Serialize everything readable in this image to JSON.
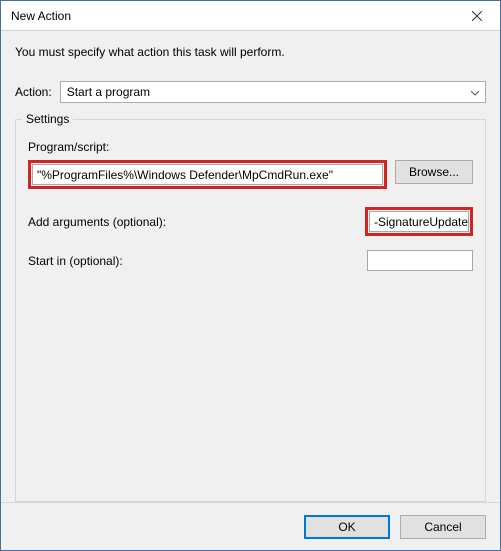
{
  "titlebar": {
    "title": "New Action"
  },
  "instruction": "You must specify what action this task will perform.",
  "action": {
    "label": "Action:",
    "selected": "Start a program"
  },
  "settings": {
    "legend": "Settings",
    "program_label": "Program/script:",
    "program_value": "\"%ProgramFiles%\\Windows Defender\\MpCmdRun.exe\"",
    "browse_label": "Browse...",
    "args_label": "Add arguments (optional):",
    "args_value": "-SignatureUpdate",
    "startin_label": "Start in (optional):",
    "startin_value": ""
  },
  "footer": {
    "ok": "OK",
    "cancel": "Cancel"
  }
}
